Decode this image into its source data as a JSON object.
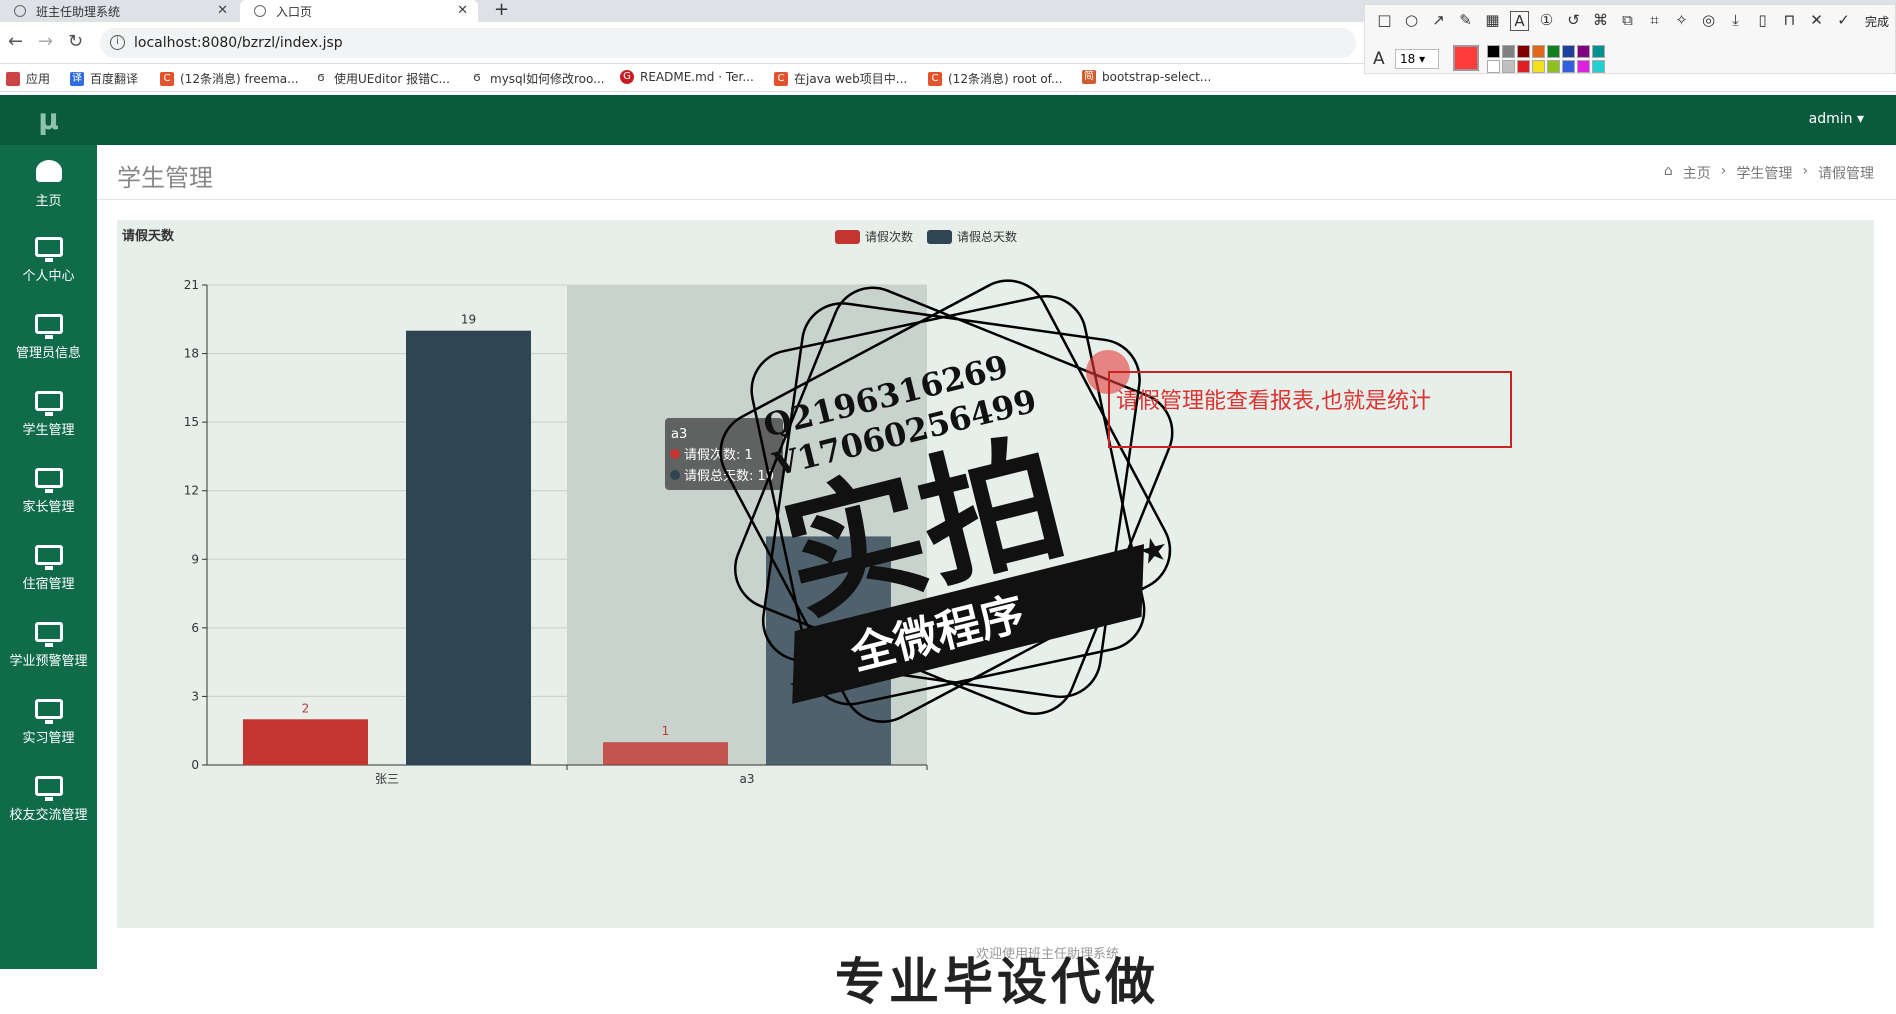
{
  "browser": {
    "tabs": [
      {
        "title": "班主任助理系统"
      },
      {
        "title": "入口页"
      }
    ],
    "url": "localhost:8080/bzrzl/index.jsp",
    "bookmarks": [
      "应用",
      "百度翻译",
      "(12条消息) freema...",
      "使用UEditor 报错C...",
      "mysql如何修改roo...",
      "README.md · Ter...",
      "在java web项目中...",
      "(12条消息) root of...",
      "bootstrap-select..."
    ]
  },
  "snap_tool": {
    "done_label": "完成",
    "font_size": "18"
  },
  "app": {
    "logo": "μ",
    "user": "admin",
    "menu": [
      "主页",
      "个人中心",
      "管理员信息",
      "学生管理",
      "家长管理",
      "住宿管理",
      "学业预警管理",
      "实习管理",
      "校友交流管理"
    ],
    "page_title": "学生管理",
    "breadcrumb": [
      "主页",
      "学生管理",
      "请假管理"
    ],
    "footer_text": "欢迎使用班主任助理系统",
    "footer_big": "专业毕设代做"
  },
  "chart_data": {
    "type": "bar",
    "title": "请假天数",
    "categories": [
      "张三",
      "a3"
    ],
    "series": [
      {
        "name": "请假次数",
        "values": [
          2,
          1
        ],
        "color": "#c23531"
      },
      {
        "name": "请假总天数",
        "values": [
          19,
          10
        ],
        "color": "#2f4554"
      }
    ],
    "ylim": [
      0,
      21
    ],
    "yticks": [
      0,
      3,
      6,
      9,
      12,
      15,
      18,
      21
    ],
    "legend": "top-center",
    "highlight_category": "a3",
    "tooltip": {
      "title": "a3",
      "lines": [
        "请假次数: 1",
        "请假总天数: 10"
      ]
    }
  },
  "overlay": {
    "note": "请假管理能查看报表,也就是统计",
    "stamp_lines": [
      "Q2196316269",
      "V17060256499"
    ],
    "stamp_main": "实拍",
    "stamp_banner": "全微程序"
  }
}
